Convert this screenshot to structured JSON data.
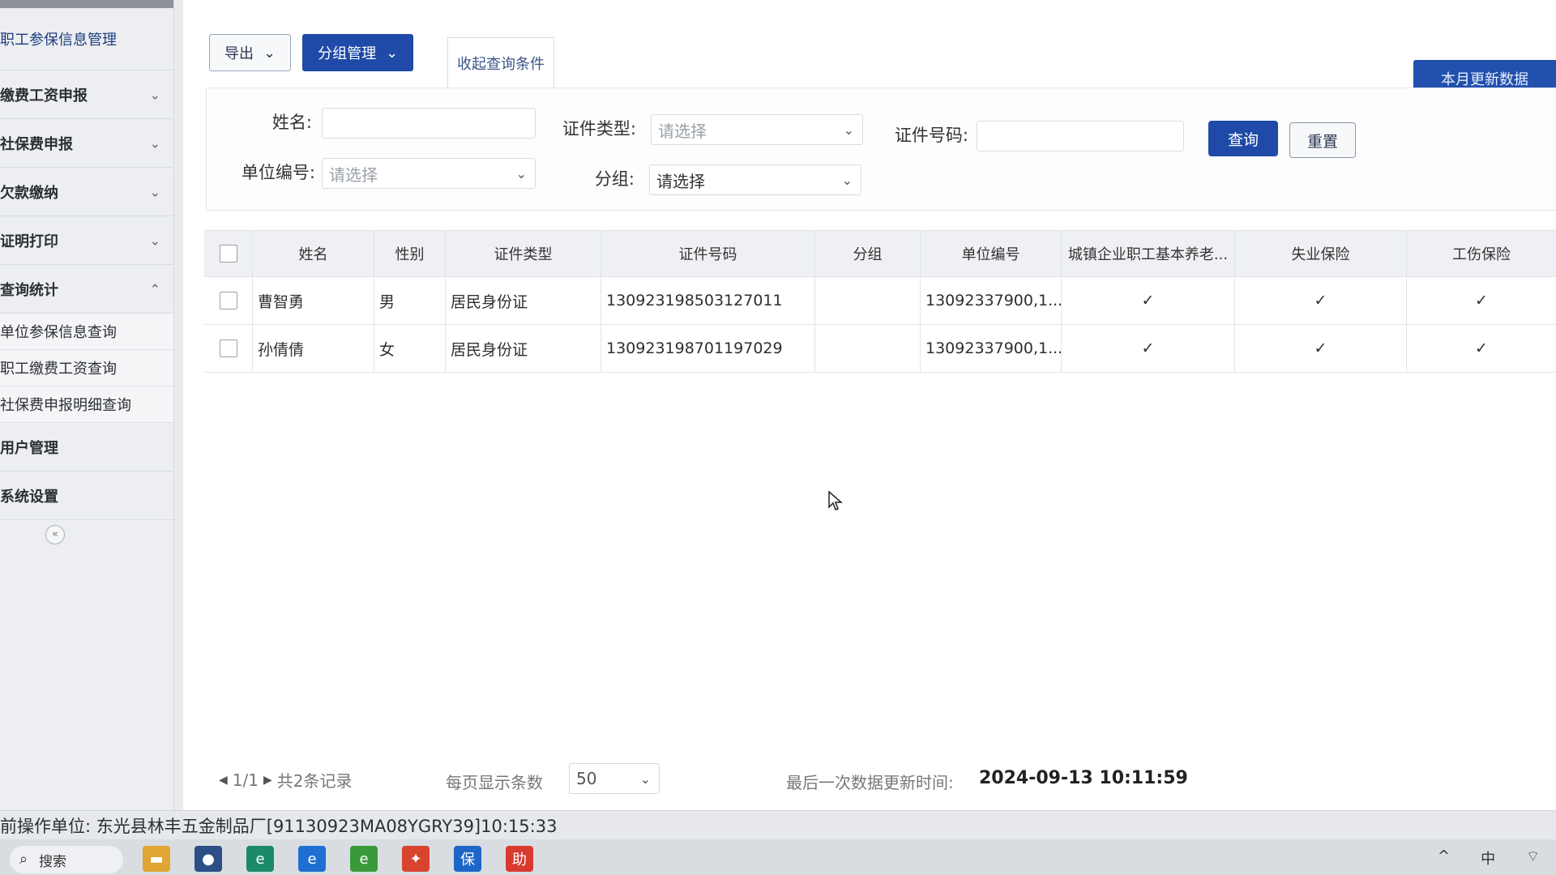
{
  "sidebar": {
    "items": [
      {
        "label": "职工参保信息管理",
        "chevron": ""
      },
      {
        "label": "缴费工资申报",
        "chevron": "⌄"
      },
      {
        "label": "社保费申报",
        "chevron": "⌄"
      },
      {
        "label": "欠款缴纳",
        "chevron": "⌄"
      },
      {
        "label": "证明打印",
        "chevron": "⌄"
      },
      {
        "label": "查询统计",
        "chevron": "⌃"
      }
    ],
    "sub_items": [
      "单位参保信息查询",
      "职工缴费工资查询",
      "社保费申报明细查询"
    ],
    "bottom_items": [
      "用户管理",
      "系统设置"
    ],
    "collapse_glyph": "«"
  },
  "toolbar": {
    "export_label": "导出",
    "group_manage_label": "分组管理",
    "collapse_query_label": "收起查询条件",
    "monthly_update_label": "本月更新数据"
  },
  "filter": {
    "name_label": "姓名:",
    "name_value": "",
    "id_type_label": "证件类型:",
    "id_type_placeholder": "请选择",
    "id_no_label": "证件号码:",
    "id_no_value": "",
    "unit_no_label": "单位编号:",
    "unit_no_placeholder": "请选择",
    "group_label": "分组:",
    "group_value": "请选择",
    "query_label": "查询",
    "reset_label": "重置"
  },
  "table": {
    "headers": [
      "姓名",
      "性别",
      "证件类型",
      "证件号码",
      "分组",
      "单位编号",
      "城镇企业职工基本养老...",
      "失业保险",
      "工伤保险"
    ],
    "rows": [
      {
        "name": "曹智勇",
        "sex": "男",
        "id_type": "居民身份证",
        "id_no": "130923198503127011",
        "group": "",
        "unit": "13092337900,1...",
        "pension": "✓",
        "unemployment": "✓",
        "injury": "✓"
      },
      {
        "name": "孙倩倩",
        "sex": "女",
        "id_type": "居民身份证",
        "id_no": "130923198701197029",
        "group": "",
        "unit": "13092337900,1...",
        "pension": "✓",
        "unemployment": "✓",
        "injury": "✓"
      }
    ]
  },
  "pagination": {
    "page_text": "1/1",
    "total_text": "共2条记录",
    "per_page_label": "每页显示条数",
    "per_page_value": "50",
    "last_update_label": "最后一次数据更新时间:",
    "last_update_value": "2024-09-13 10:11:59"
  },
  "status": {
    "text": "前操作单位: 东光县林丰五金制品厂[91130923MA08YGRY39]10:15:33"
  },
  "taskbar": {
    "search_label": "搜索",
    "icons": [
      {
        "name": "folder-icon",
        "glyph": "▬",
        "color": "#e0a532"
      },
      {
        "name": "app-icon",
        "glyph": "●",
        "color": "#2b4f86"
      },
      {
        "name": "edge-icon",
        "glyph": "e",
        "color": "#1a8a6a"
      },
      {
        "name": "browser-icon",
        "glyph": "e",
        "color": "#1e6fd1"
      },
      {
        "name": "ie-icon",
        "glyph": "e",
        "color": "#3a9a3a"
      },
      {
        "name": "app2-icon",
        "glyph": "✦",
        "color": "#d9442f"
      },
      {
        "name": "bao-icon",
        "glyph": "保",
        "color": "#1e66c9"
      },
      {
        "name": "zhu-icon",
        "glyph": "助",
        "color": "#d93a2f"
      }
    ],
    "tray": [
      "^",
      "中",
      "⌔"
    ]
  }
}
